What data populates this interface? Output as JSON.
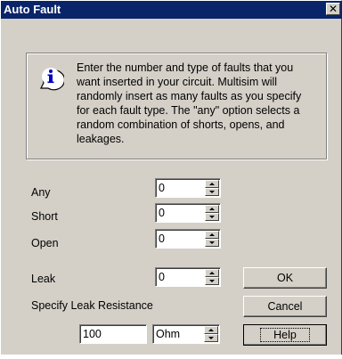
{
  "window": {
    "title": "Auto Fault",
    "close_glyph": "✕"
  },
  "info": {
    "icon": "information-icon",
    "text": "Enter the number and type of faults that you want inserted in your circuit. Multisim will randomly insert as many faults as you specify for each fault type. The \"any\" option selects a random combination of shorts, opens, and leakages."
  },
  "fields": {
    "any": {
      "label": "Any",
      "value": "0"
    },
    "short": {
      "label": "Short",
      "value": "0"
    },
    "open": {
      "label": "Open",
      "value": "0"
    },
    "leak": {
      "label": "Leak",
      "value": "0"
    }
  },
  "leak_resistance": {
    "label": "Specify Leak Resistance",
    "value": "100",
    "unit": "Ohm"
  },
  "buttons": {
    "ok": "OK",
    "cancel": "Cancel",
    "help": "Help"
  },
  "colors": {
    "titlebar": "#0a246a",
    "face": "#d4d0c8"
  }
}
